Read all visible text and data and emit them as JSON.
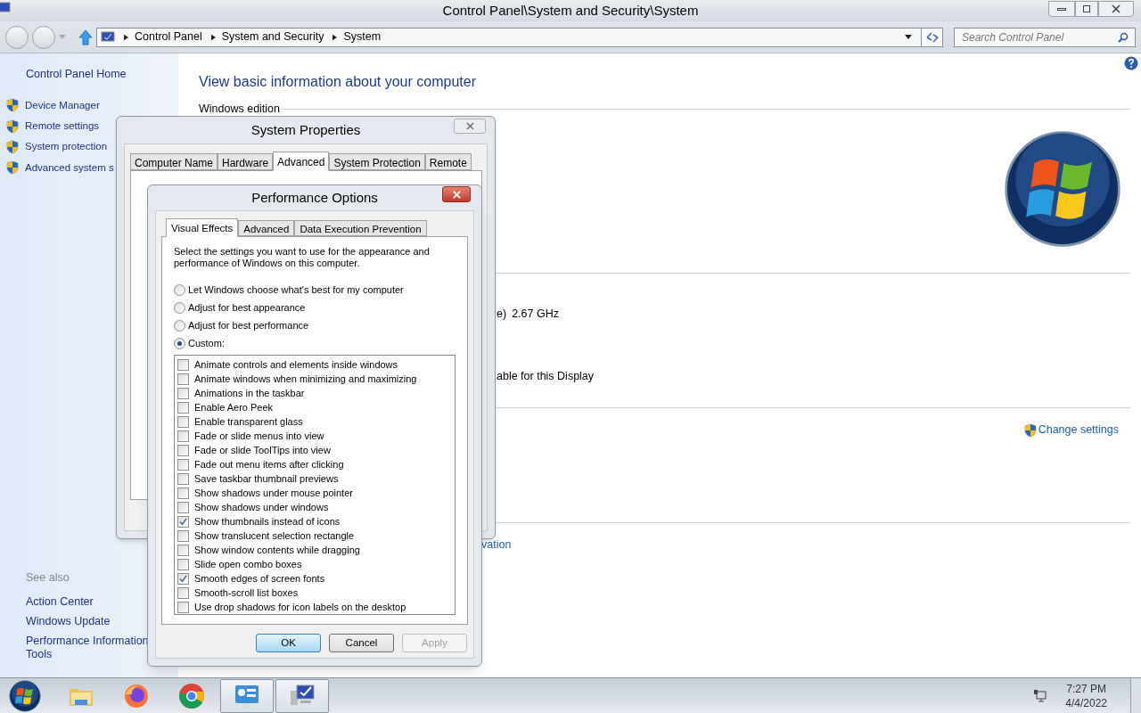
{
  "window": {
    "title": "Control Panel\\System and Security\\System"
  },
  "address_bar": {
    "breadcrumbs": [
      "Control Panel",
      "System and Security",
      "System"
    ]
  },
  "search": {
    "placeholder": "Search Control Panel"
  },
  "sidebar": {
    "home": "Control Panel Home",
    "tasks": [
      "Device Manager",
      "Remote settings",
      "System protection",
      "Advanced system s"
    ],
    "see_also_heading": "See also",
    "links": [
      {
        "lines": [
          "Action Center"
        ]
      },
      {
        "lines": [
          "Windows Update"
        ]
      },
      {
        "lines": [
          "Performance Information",
          "Tools"
        ]
      }
    ]
  },
  "content": {
    "heading": "View basic information about your computer",
    "section": "Windows edition",
    "processor_fragment": "e)",
    "processor_speed": "2.67 GHz",
    "display_fragment": "able for this Display",
    "change_settings": "Change settings",
    "activation_fragment": "vation"
  },
  "system_properties": {
    "title": "System Properties",
    "tabs": [
      {
        "label": "Computer Name",
        "selected": false
      },
      {
        "label": "Hardware",
        "selected": false
      },
      {
        "label": "Advanced",
        "selected": true
      },
      {
        "label": "System Protection",
        "selected": false
      },
      {
        "label": "Remote",
        "selected": false
      }
    ]
  },
  "performance_options": {
    "title": "Performance Options",
    "tabs": [
      {
        "label": "Visual Effects",
        "selected": true
      },
      {
        "label": "Advanced",
        "selected": false
      },
      {
        "label": "Data Execution Prevention",
        "selected": false
      }
    ],
    "description": "Select the settings you want to use for the appearance and performance of Windows on this computer.",
    "radios": [
      {
        "label": "Let Windows choose what's best for my computer",
        "selected": false
      },
      {
        "label": "Adjust for best appearance",
        "selected": false
      },
      {
        "label": "Adjust for best performance",
        "selected": false
      },
      {
        "label": "Custom:",
        "selected": true
      }
    ],
    "effects": [
      {
        "label": "Animate controls and elements inside windows",
        "checked": false
      },
      {
        "label": "Animate windows when minimizing and maximizing",
        "checked": false
      },
      {
        "label": "Animations in the taskbar",
        "checked": false
      },
      {
        "label": "Enable Aero Peek",
        "checked": false
      },
      {
        "label": "Enable transparent glass",
        "checked": false
      },
      {
        "label": "Fade or slide menus into view",
        "checked": false
      },
      {
        "label": "Fade or slide ToolTips into view",
        "checked": false
      },
      {
        "label": "Fade out menu items after clicking",
        "checked": false
      },
      {
        "label": "Save taskbar thumbnail previews",
        "checked": false
      },
      {
        "label": "Show shadows under mouse pointer",
        "checked": false
      },
      {
        "label": "Show shadows under windows",
        "checked": false
      },
      {
        "label": "Show thumbnails instead of icons",
        "checked": true
      },
      {
        "label": "Show translucent selection rectangle",
        "checked": false
      },
      {
        "label": "Show window contents while dragging",
        "checked": false
      },
      {
        "label": "Slide open combo boxes",
        "checked": false
      },
      {
        "label": "Smooth edges of screen fonts",
        "checked": true
      },
      {
        "label": "Smooth-scroll list boxes",
        "checked": false
      },
      {
        "label": "Use drop shadows for icon labels on the desktop",
        "checked": false
      }
    ],
    "buttons": [
      {
        "label": "OK",
        "kind": "default",
        "disabled": false
      },
      {
        "label": "Cancel",
        "kind": "normal",
        "disabled": false
      },
      {
        "label": "Apply",
        "kind": "normal",
        "disabled": true
      }
    ]
  },
  "taskbar": {
    "apps": [
      {
        "kind": "folder",
        "selected": false
      },
      {
        "kind": "firefox",
        "selected": false
      },
      {
        "kind": "chrome",
        "selected": false
      },
      {
        "kind": "control-panel",
        "selected": true
      },
      {
        "kind": "system",
        "selected": true
      }
    ],
    "time": "7:27 PM",
    "date": "4/4/2022"
  }
}
